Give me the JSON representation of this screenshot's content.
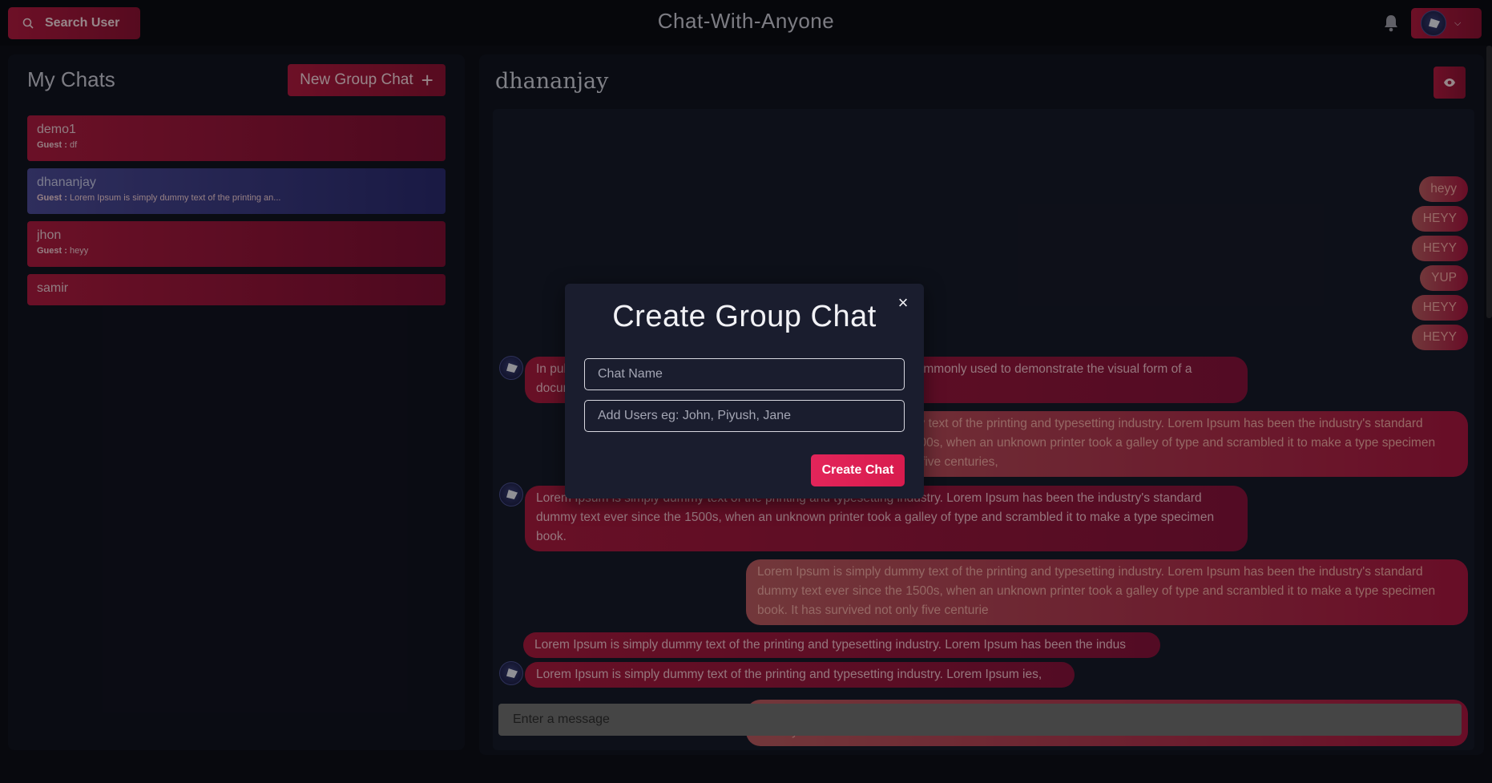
{
  "topbar": {
    "search_label": "Search User",
    "app_title": "Chat-With-Anyone",
    "search_icon": "search-icon",
    "bell_icon": "bell-icon",
    "chevron_icon": "chevron-down-icon"
  },
  "sidebar": {
    "title": "My Chats",
    "new_group_label": "New Group Chat",
    "new_group_plus": "+",
    "chats": [
      {
        "name": "demo1",
        "sender": "Guest :",
        "latest": "df"
      },
      {
        "name": "dhananjay",
        "sender": "Guest :",
        "latest": "Lorem Ipsum is simply dummy text of the printing an..."
      },
      {
        "name": "jhon",
        "sender": "Guest :",
        "latest": "heyy"
      },
      {
        "name": "samir"
      }
    ]
  },
  "chat": {
    "title": "dhananjay",
    "eye_icon": "eye-icon",
    "input_placeholder": "Enter a message",
    "messages": [
      {
        "text": "heyy"
      },
      {
        "text": "HEYY"
      },
      {
        "text": "HEYY"
      },
      {
        "text": "YUP"
      },
      {
        "text": "HEYY"
      },
      {
        "text": "HEYY"
      },
      {
        "text": "In publishing and graphic design, Lorem ipsum is a placeholder text commonly used to demonstrate the visual form of a document"
      },
      {
        "text": "Lorem Ipsum is simply dummy text of the printing and typesetting industry. Lorem Ipsum has been the industry's standard dummy text ever since the 1500s, when an unknown printer took a galley of type and scrambled it to make a type specimen book. It has survived not only five centuries,"
      },
      {
        "text": "Lorem Ipsum is simply dummy text of the printing and typesetting industry. Lorem Ipsum has been the industry's standard dummy text ever since the 1500s, when an unknown printer took a galley of type and scrambled it to make a type specimen book."
      },
      {
        "text": "Lorem Ipsum is simply dummy text of the printing and typesetting industry. Lorem Ipsum has been the industry's standard dummy text ever since the 1500s, when an unknown printer took a galley of type and scrambled it to make a type specimen book. It has survived not only five centurie"
      },
      {
        "text": "Lorem Ipsum is simply dummy text of the printing and typesetting industry. Lorem Ipsum has been the indus"
      },
      {
        "text": "Lorem Ipsum is simply dummy text of the printing and typesetting industry. Lorem Ipsum ies,"
      },
      {
        "text": "Lorem Ipsum is simply dummy text of the printing and typesetting industry. Lorem Ipsum has been the industry's standard dummy text ever since the 1500s"
      }
    ]
  },
  "modal": {
    "title": "Create Group Chat",
    "close_symbol": "×",
    "chat_name_placeholder": "Chat Name",
    "users_placeholder": "Add Users eg: John, Piyush, Jane",
    "create_label": "Create Chat"
  },
  "colors": {
    "accent": "#b01a3f",
    "active_chat": "#4c4b96",
    "background": "#0d0f17",
    "create_button": "#e3255a"
  }
}
